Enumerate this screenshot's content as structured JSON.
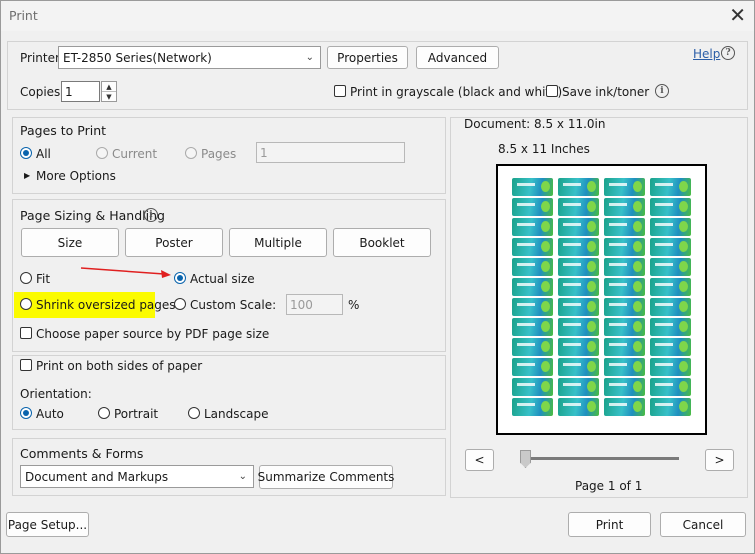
{
  "window": {
    "title": "Print",
    "close_glyph": "✕"
  },
  "printer": {
    "label": "Printer:",
    "selected": "ET-2850 Series(Network)",
    "properties_label": "Properties",
    "advanced_label": "Advanced",
    "help_label": "Help",
    "copies_label": "Copies:",
    "copies_value": "1",
    "grayscale_label": "Print in grayscale (black and white)",
    "save_ink_label": "Save ink/toner"
  },
  "pages_to_print": {
    "title": "Pages to Print",
    "all_label": "All",
    "current_label": "Current",
    "pages_label": "Pages",
    "pages_value": "1",
    "more_options_label": "More Options"
  },
  "page_sizing": {
    "title": "Page Sizing & Handling",
    "tabs": [
      "Size",
      "Poster",
      "Multiple",
      "Booklet"
    ],
    "fit_label": "Fit",
    "actual_size_label": "Actual size",
    "shrink_label": "Shrink oversized pages",
    "custom_scale_label": "Custom Scale:",
    "custom_scale_value": "100",
    "percent_label": "%",
    "paper_source_label": "Choose paper source by PDF page size"
  },
  "duplex": {
    "both_sides_label": "Print on both sides of paper"
  },
  "orientation": {
    "label": "Orientation:",
    "auto_label": "Auto",
    "portrait_label": "Portrait",
    "landscape_label": "Landscape"
  },
  "comments": {
    "title": "Comments & Forms",
    "selected": "Document and Markups",
    "summarize_label": "Summarize Comments"
  },
  "preview": {
    "document_label": "Document: 8.5 x 11.0in",
    "size_label": "8.5 x 11 Inches",
    "prev_label": "<",
    "next_label": ">",
    "page_indicator": "Page 1 of 1"
  },
  "footer": {
    "page_setup_label": "Page Setup...",
    "print_label": "Print",
    "cancel_label": "Cancel"
  },
  "colors": {
    "accent": "#0a64ad",
    "highlight": "#fbfb00",
    "annotation_arrow": "#e02020",
    "link": "#2b5ea7"
  }
}
